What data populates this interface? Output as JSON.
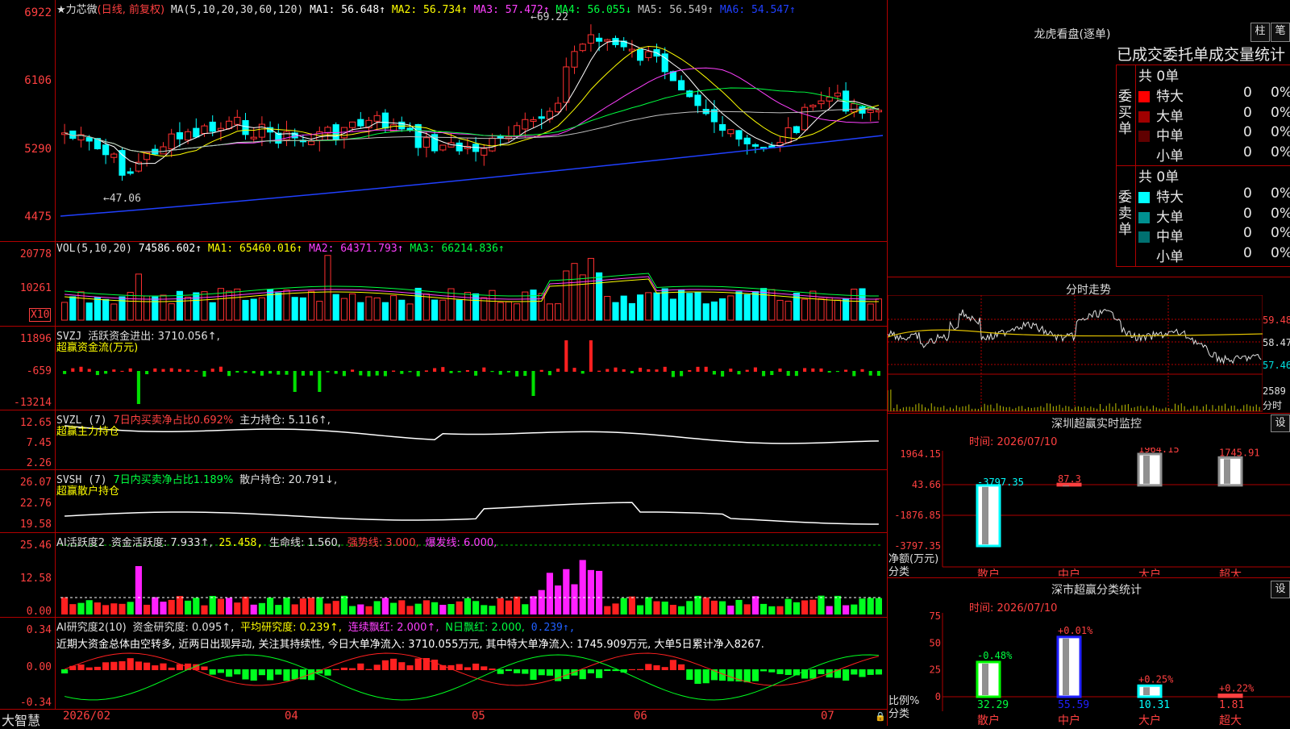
{
  "app": {
    "brand": "大智慧"
  },
  "main_chart": {
    "title": "★力芯微",
    "period": "(日线, 前复权)",
    "ma_def": "MA(5,10,20,30,60,120)",
    "ma": [
      {
        "name": "MA1:",
        "value": "56.648↑",
        "color": "#ffffff"
      },
      {
        "name": "MA2:",
        "value": "56.734↑",
        "color": "#ffff00"
      },
      {
        "name": "MA3:",
        "value": "57.472↑",
        "color": "#ff40ff"
      },
      {
        "name": "MA4:",
        "value": "56.055↓",
        "color": "#00ff40"
      },
      {
        "name": "MA5:",
        "value": "56.549↑",
        "color": "#c0c0c0"
      },
      {
        "name": "MA6:",
        "value": "54.547↑",
        "color": "#2040ff"
      }
    ],
    "y_ticks": [
      "6922",
      "6106",
      "5290",
      "4475"
    ],
    "high_note": "←69.22",
    "low_note": "←47.06"
  },
  "vol_panel": {
    "title": "VOL(5,10,20)",
    "value": "74586.602↑",
    "ma": [
      {
        "name": "MA1:",
        "value": "65460.016↑",
        "color": "#ffff00"
      },
      {
        "name": "MA2:",
        "value": "64371.793↑",
        "color": "#ff40ff"
      },
      {
        "name": "MA3:",
        "value": "66214.836↑",
        "color": "#00ff40"
      }
    ],
    "y_ticks": [
      "20778",
      "10261"
    ],
    "unit": "X10"
  },
  "svzj_panel": {
    "title": "SVZJ",
    "desc": "活跃资金进出: 3710.056↑,",
    "sub": "超赢资金流(万元)",
    "y_ticks": [
      "11896",
      "-659",
      "-13214"
    ]
  },
  "svzl_panel": {
    "title": "SVZL (7)",
    "desc_red": "7日内买卖净占比0.692%",
    "desc": "主力持仓: 5.116↑,",
    "sub": "超赢主力持仓",
    "y_ticks": [
      "12.65",
      "7.45",
      "2.26"
    ]
  },
  "svsh_panel": {
    "title": "SVSH (7)",
    "desc_green": "7日内买卖净占比1.189%",
    "desc": "散户持仓: 20.791↓,",
    "sub": "超赢散户持仓",
    "y_ticks": [
      "26.07",
      "22.76",
      "19.58"
    ]
  },
  "ai_active_panel": {
    "title": "AI活跃度2",
    "a": "资金活跃度: 7.933↑,",
    "b": "25.458,",
    "c": "生命线: 1.560,",
    "d": "强势线: 3.000,",
    "e": "爆发线: 6.000,",
    "y_ticks": [
      "25.46",
      "12.58",
      "0.00"
    ]
  },
  "ai_research_panel": {
    "title": "AI研究度2(10)",
    "a": "资金研究度: 0.095↑,",
    "b": "平均研究度: 0.239↑,",
    "c": "连续飘红: 2.000↑,",
    "d": "N日飘红: 2.000,",
    "e": "0.239↑,",
    "comment": "近期大资金总体由空转多, 近两日出现异动, 关注其持续性, 今日大单净流入: 3710.055万元, 其中特大单净流入: 1745.909万元, 大单5日累计净入8267.",
    "y_ticks": [
      "0.34",
      "0.00",
      "-0.34"
    ]
  },
  "x_axis": {
    "months": [
      "2026/02",
      "04",
      "05",
      "06",
      "07"
    ]
  },
  "dragon": {
    "title": "龙虎看盘(逐单)",
    "btn1": "柱",
    "btn2": "笔",
    "header": "已成交委托单成交量统计",
    "buy_label": "委买单",
    "sell_label": "委卖单",
    "buy_total": "共 0单",
    "sell_total": "共 0单",
    "buy_rows": [
      {
        "label": "特大",
        "value": "0",
        "pct": "0%",
        "color": "#ff0000"
      },
      {
        "label": "大单",
        "value": "0",
        "pct": "0%",
        "color": "#a00000"
      },
      {
        "label": "中单",
        "value": "0",
        "pct": "0%",
        "color": "#600000"
      },
      {
        "label": "小单",
        "value": "0",
        "pct": "0%",
        "color": "#000000"
      }
    ],
    "sell_rows": [
      {
        "label": "特大",
        "value": "0",
        "pct": "0%",
        "color": "#00ffff"
      },
      {
        "label": "大单",
        "value": "0",
        "pct": "0%",
        "color": "#009090"
      },
      {
        "label": "中单",
        "value": "0",
        "pct": "0%",
        "color": "#007070"
      },
      {
        "label": "小单",
        "value": "0",
        "pct": "0%",
        "color": "#000000"
      }
    ]
  },
  "intraday": {
    "title": "分时走势",
    "y_ticks": [
      "59.48",
      "58.47",
      "57.46"
    ],
    "vol_tick": "2589",
    "vol_unit": "分时"
  },
  "sz_monitor": {
    "title": "深圳超赢实时监控",
    "btn": "设",
    "time": "时间: 2026/07/10",
    "y_ticks": [
      "1964.15",
      "43.66",
      "-1876.85",
      "-3797.35"
    ],
    "y_unit": "净额(万元)",
    "x_unit": "分类",
    "bars": [
      {
        "cat": "散户",
        "value": -3797.35,
        "label": "-3797.35"
      },
      {
        "cat": "中户",
        "value": 87.3,
        "label": "87.3"
      },
      {
        "cat": "大户",
        "value": 1964.15,
        "label": "1964.15"
      },
      {
        "cat": "超大",
        "value": 1745.91,
        "label": "1745.91"
      }
    ]
  },
  "sz_classify": {
    "title": "深市超赢分类统计",
    "btn": "设",
    "time": "时间: 2026/07/10",
    "y_ticks": [
      "75",
      "50",
      "25",
      "0"
    ],
    "y_unit": "比例%",
    "x_unit": "分类",
    "bars": [
      {
        "cat": "散户",
        "value": 32.29,
        "label": "32.29",
        "chg": "-0.48%"
      },
      {
        "cat": "中户",
        "value": 55.59,
        "label": "55.59",
        "chg": "+0.01%"
      },
      {
        "cat": "大户",
        "value": 10.31,
        "label": "10.31",
        "chg": "+0.25%"
      },
      {
        "cat": "超大",
        "value": 1.81,
        "label": "1.81",
        "chg": "+0.22%"
      }
    ]
  },
  "chart_data": [
    {
      "type": "bar",
      "title": "深圳超赢实时监控",
      "xlabel": "分类",
      "ylabel": "净额(万元)",
      "categories": [
        "散户",
        "中户",
        "大户",
        "超大"
      ],
      "values": [
        -3797.35,
        87.3,
        1964.15,
        1745.91
      ],
      "ylim": [
        -3797.35,
        1964.15
      ]
    },
    {
      "type": "bar",
      "title": "深市超赢分类统计",
      "xlabel": "分类",
      "ylabel": "比例%",
      "categories": [
        "散户",
        "中户",
        "大户",
        "超大"
      ],
      "values": [
        32.29,
        55.59,
        10.31,
        1.81
      ],
      "ylim": [
        0,
        75
      ]
    }
  ]
}
